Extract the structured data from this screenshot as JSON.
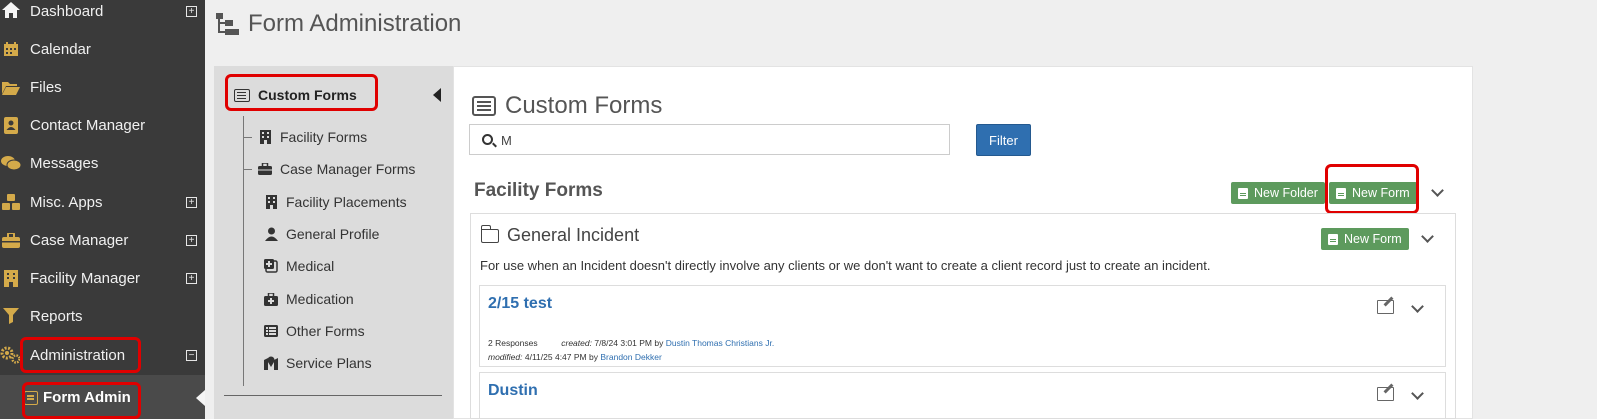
{
  "nav": {
    "items": [
      {
        "label": "Dashboard",
        "icon": "home-icon",
        "expandable": true
      },
      {
        "label": "Calendar",
        "icon": "calendar-icon"
      },
      {
        "label": "Files",
        "icon": "folder-open-icon"
      },
      {
        "label": "Contact Manager",
        "icon": "address-book-icon"
      },
      {
        "label": "Messages",
        "icon": "comments-icon"
      },
      {
        "label": "Misc. Apps",
        "icon": "cubes-icon",
        "expandable": true
      },
      {
        "label": "Case Manager",
        "icon": "briefcase-icon",
        "expandable": true
      },
      {
        "label": "Facility Manager",
        "icon": "building-icon",
        "expandable": true
      },
      {
        "label": "Reports",
        "icon": "filter-icon"
      },
      {
        "label": "Administration",
        "icon": "cogs-icon",
        "expandable": true,
        "expanded": true
      }
    ],
    "sub_item": {
      "label": "Form Admin",
      "icon": "form-icon"
    },
    "expand_symbol": "+",
    "collapse_symbol": "−",
    "accent_color": "#d4aa4a"
  },
  "header": {
    "title": "Form Administration"
  },
  "tree": {
    "root_label": "Custom Forms",
    "items": [
      {
        "label": "Facility Forms",
        "icon": "building-icon",
        "level": 1
      },
      {
        "label": "Case Manager Forms",
        "icon": "briefcase-icon",
        "level": 1
      },
      {
        "label": "Facility Placements",
        "icon": "building-icon",
        "level": 2
      },
      {
        "label": "General Profile",
        "icon": "user-icon",
        "level": 2
      },
      {
        "label": "Medical",
        "icon": "medical-icon",
        "level": 2
      },
      {
        "label": "Medication",
        "icon": "medkit-icon",
        "level": 2
      },
      {
        "label": "Other Forms",
        "icon": "list-icon",
        "level": 2
      },
      {
        "label": "Service Plans",
        "icon": "map-marker-icon",
        "level": 2
      }
    ]
  },
  "main": {
    "title": "Custom Forms",
    "search": {
      "value": "M"
    },
    "filter_label": "Filter",
    "section": {
      "heading": "Facility Forms",
      "new_folder_label": "New Folder",
      "new_form_label": "New Form"
    },
    "folder": {
      "name": "General Incident",
      "new_form_label": "New Form",
      "description": "For use when an Incident doesn't directly involve any clients or we don't want to create a client record just to create an incident."
    },
    "forms": [
      {
        "title": "2/15 test",
        "responses": "2 Responses",
        "created_label": "created:",
        "created": "7/8/24 3:01 PM",
        "created_by_word": "by",
        "created_by": "Dustin Thomas Christians Jr.",
        "modified_label": "modified:",
        "modified": "4/11/25 4:47 PM",
        "modified_by_word": "by",
        "modified_by": "Brandon Dekker"
      },
      {
        "title": "Dustin"
      }
    ]
  },
  "colors": {
    "primary_blue": "#2f6fb0",
    "success_green": "#5d9a5d",
    "highlight_red": "#e00000",
    "nav_bg": "#3a3a3a"
  }
}
